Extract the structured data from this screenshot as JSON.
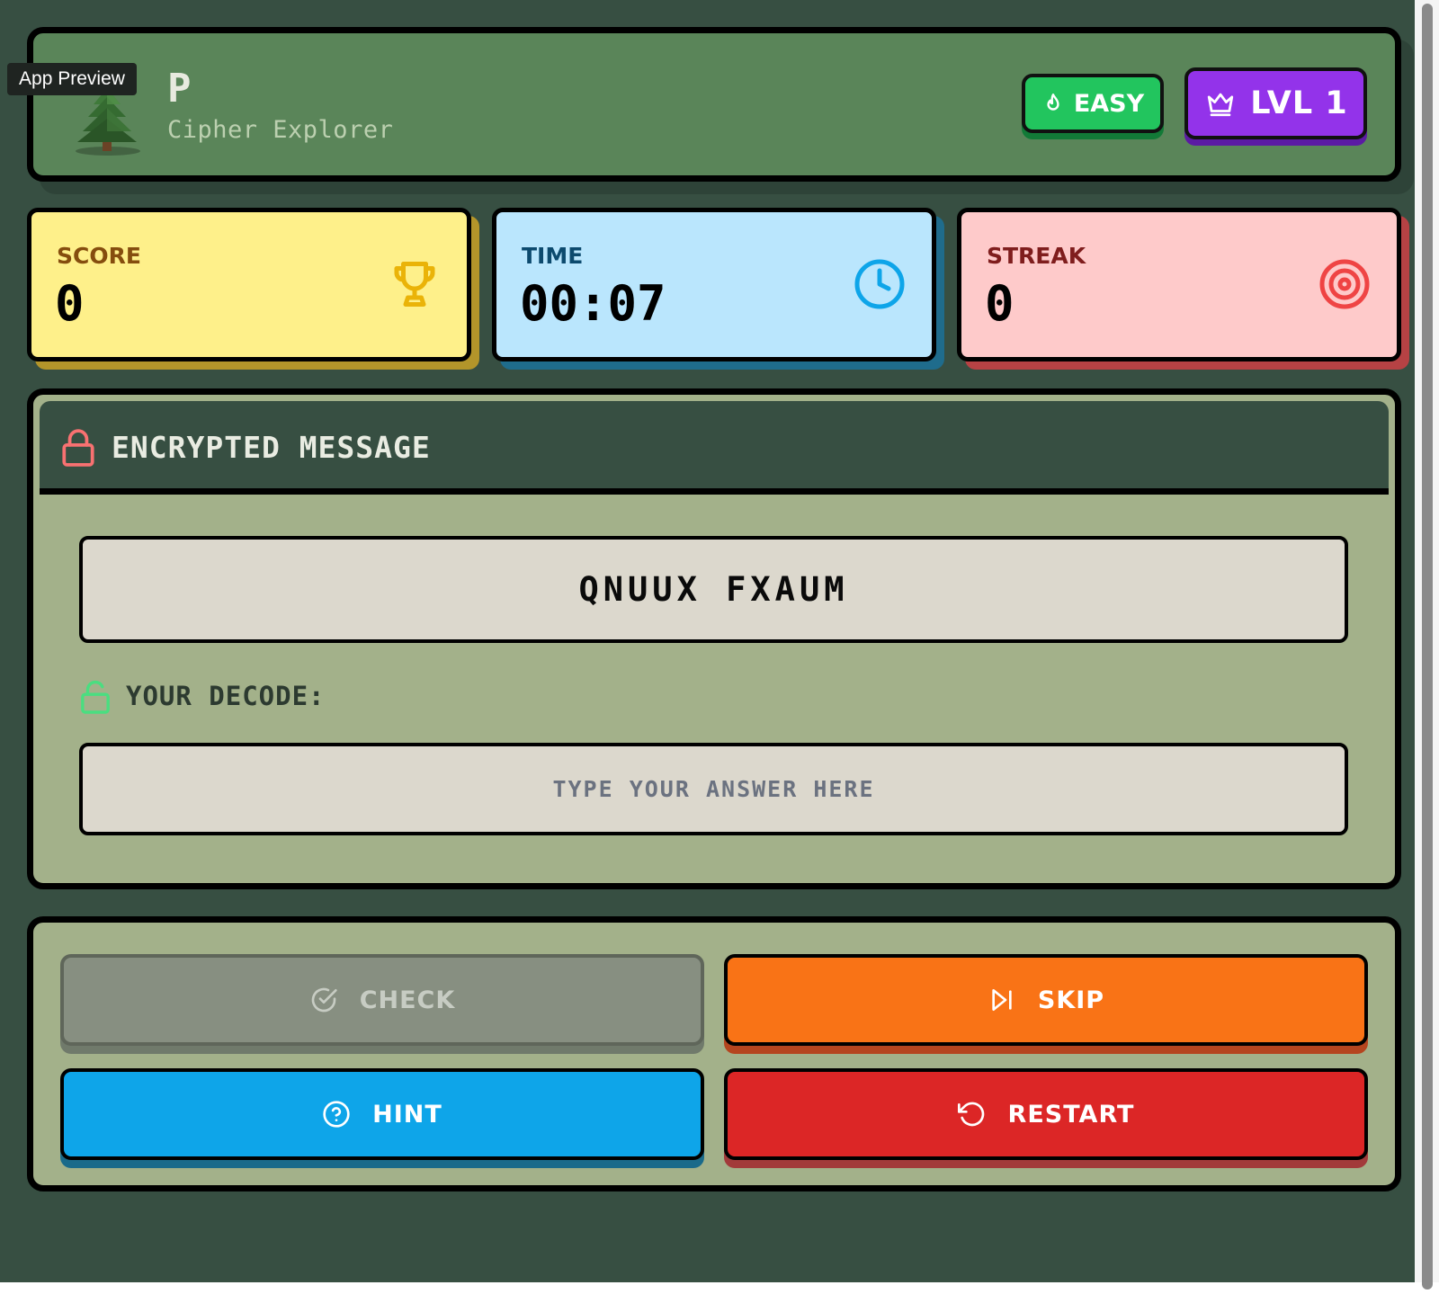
{
  "tooltip": "App Preview",
  "header": {
    "logo_icon": "pine-tree-icon",
    "title": "P",
    "subtitle": "Cipher Explorer",
    "difficulty_label": "EASY",
    "difficulty_icon": "flame-icon",
    "level_label": "LVL 1",
    "level_icon": "crown-icon"
  },
  "stats": {
    "score": {
      "label": "SCORE",
      "value": "0",
      "icon": "trophy-icon"
    },
    "time": {
      "label": "TIME",
      "value": "00:07",
      "icon": "clock-icon"
    },
    "streak": {
      "label": "STREAK",
      "value": "0",
      "icon": "target-icon"
    }
  },
  "message": {
    "title": "ENCRYPTED MESSAGE",
    "title_icon": "lock-icon",
    "cipher_text": "QNUUX FXAUM",
    "decode_label": "YOUR DECODE:",
    "decode_icon": "unlock-icon",
    "answer_value": "",
    "answer_placeholder": "TYPE YOUR ANSWER HERE"
  },
  "actions": {
    "check": {
      "label": "CHECK",
      "icon": "check-circle-icon",
      "disabled": true
    },
    "skip": {
      "label": "SKIP",
      "icon": "skip-forward-icon"
    },
    "hint": {
      "label": "HINT",
      "icon": "help-circle-icon"
    },
    "restart": {
      "label": "RESTART",
      "icon": "rotate-ccw-icon"
    }
  },
  "colors": {
    "background": "#374f42",
    "header": "#5a8559",
    "panel": "#a3b18a",
    "easy": "#22c55e",
    "level": "#9333ea",
    "score_card": "#fef08a",
    "time_card": "#bae6fd",
    "streak_card": "#fecaca",
    "check": "#878f81",
    "skip": "#f97316",
    "hint": "#0ea5e9",
    "restart": "#dc2626"
  }
}
